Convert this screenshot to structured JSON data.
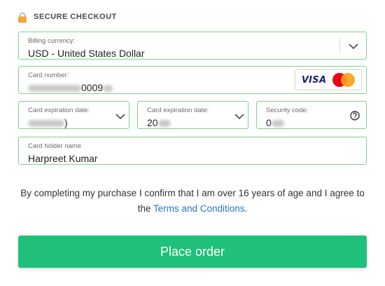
{
  "header": {
    "title": "SECURE CHECKOUT",
    "icon": "lock-icon"
  },
  "billing": {
    "label": "Billing currency:",
    "value": "USD - United States Dollar"
  },
  "card_number": {
    "label": "Card number:",
    "visible_tail": "0009",
    "brands": {
      "visa": "VISA",
      "mastercard": "mastercard-icon"
    }
  },
  "exp_month": {
    "label": "Card expiration date:",
    "visible_tail": ")"
  },
  "exp_year": {
    "label": "Card expiration date:",
    "visible_head": "20"
  },
  "security": {
    "label": "Security code:",
    "visible_head": "0"
  },
  "holder": {
    "label": "Card holder name",
    "value": "Harpreet Kumar"
  },
  "legal": {
    "text": "By completing my purchase I confirm that I am over 16 years of age and I agree to the ",
    "link": "Terms and Conditions",
    "suffix": "."
  },
  "button": {
    "label": "Place order"
  },
  "colors": {
    "accent": "#1fc079",
    "border": "#7fd28c",
    "link": "#2c72c7"
  }
}
